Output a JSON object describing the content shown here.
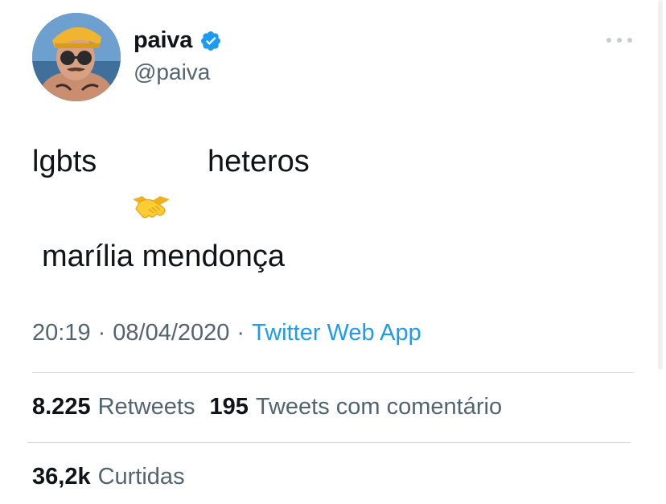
{
  "tweet": {
    "author": {
      "display_name": "paiva",
      "handle": "@paiva",
      "verified": true,
      "verified_icon": "verified-badge-icon",
      "avatar": "avatar-photo"
    },
    "more_icon": "more-horizontal-icon",
    "text": {
      "line1_left": "lgbts",
      "line1_right": "heteros",
      "emoji": "handshake-emoji",
      "line3": "marília mendonça"
    },
    "meta": {
      "time": "20:19",
      "separator": "·",
      "date": "08/04/2020",
      "source": "Twitter Web App"
    },
    "stats": {
      "retweets_count": "8.225",
      "retweets_label": "Retweets",
      "quotes_count": "195",
      "quotes_label": "Tweets com comentário",
      "likes_count": "36,2k",
      "likes_label": "Curtidas"
    }
  },
  "colors": {
    "text": "#0f1419",
    "secondary": "#536471",
    "link": "#1d9bf0",
    "verified": "#1d9bf0",
    "divider": "#d7dbdf"
  }
}
